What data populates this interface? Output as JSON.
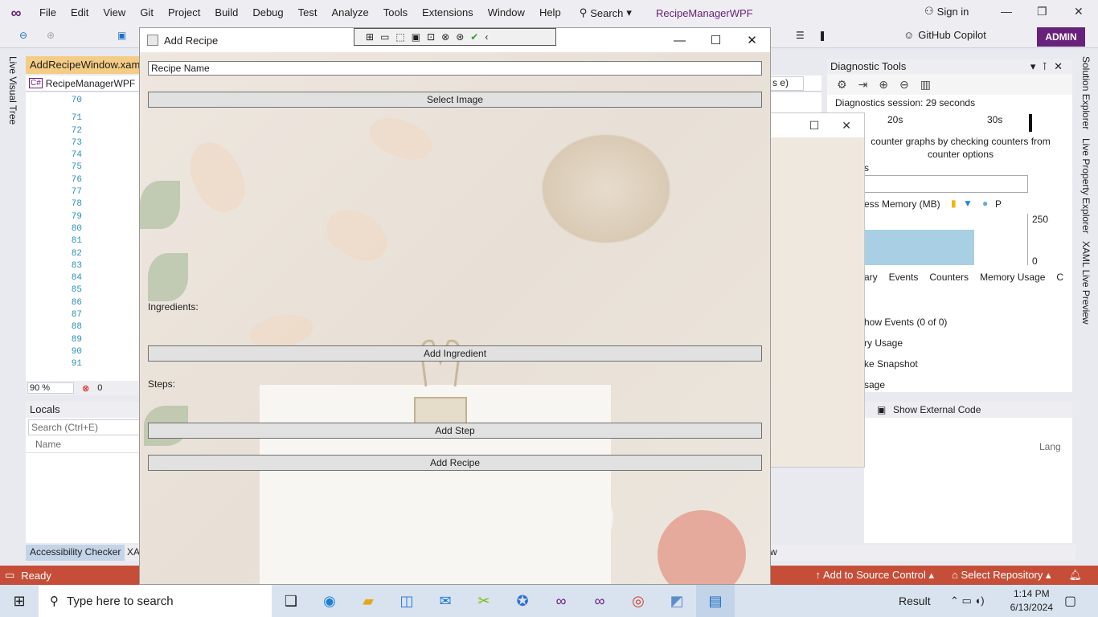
{
  "menubar": {
    "items": [
      "File",
      "Edit",
      "View",
      "Git",
      "Project",
      "Build",
      "Debug",
      "Test",
      "Analyze",
      "Tools",
      "Extensions",
      "Window",
      "Help"
    ],
    "search_label": "Search",
    "solution_name": "RecipeManagerWPF",
    "sign_in": "Sign in"
  },
  "toolbar": {
    "copilot_label": "GitHub Copilot",
    "admin_badge": "ADMIN"
  },
  "left_rail": {
    "tab": "Live Visual Tree"
  },
  "right_rail": {
    "tabs": [
      "Solution Explorer",
      "Live Property Explorer",
      "XAML Live Preview"
    ]
  },
  "editor": {
    "tab_label": "AddRecipeWindow.xaml",
    "project_dropdown": "RecipeManagerWPF",
    "line_numbers": [
      "70",
      "",
      "71",
      "72",
      "73",
      "74",
      "75",
      "76",
      "77",
      "78",
      "79",
      "80",
      "81",
      "82",
      "83",
      "84",
      "85",
      "86",
      "87",
      "88",
      "89",
      "90",
      "91"
    ],
    "zoom": "90 %",
    "error_count": "0",
    "member_dropdown": "s e)"
  },
  "locals": {
    "title": "Locals",
    "search_placeholder": "Search (Ctrl+E)",
    "column_name": "Name",
    "column_lang": "Lang"
  },
  "diagnostics": {
    "title": "Diagnostic Tools",
    "session": "Diagnostics session: 29 seconds",
    "timeline_20": "20s",
    "timeline_30": "30s",
    "hint": "counter graphs by checking counters from counter options",
    "section_events": "s",
    "memory_label": "ess Memory (MB)",
    "memory_legend_p": "P",
    "y_max": "250",
    "y_min": "0",
    "tabs": [
      "ary",
      "Events",
      "Counters",
      "Memory Usage",
      "C"
    ],
    "rows": [
      "how Events (0 of 0)",
      "ry Usage",
      "ke Snapshot",
      "sage"
    ]
  },
  "call_stack": {
    "show_external": "Show External Code"
  },
  "bottom_tabs": {
    "accessibility": "Accessibility Checker",
    "xa": "XA",
    "w": "w"
  },
  "statusbar": {
    "ready": "Ready",
    "add_source": "Add to Source Control",
    "select_repo": "Select Repository"
  },
  "taskbar": {
    "search_placeholder": "Type here to search",
    "result": "Result",
    "time": "1:14 PM",
    "date": "6/13/2024"
  },
  "dialog": {
    "title": "Add Recipe",
    "recipe_name_value": "Recipe Name",
    "select_image": "Select Image",
    "ingredients_label": "Ingredients:",
    "add_ingredient": "Add Ingredient",
    "steps_label": "Steps:",
    "add_step": "Add Step",
    "add_recipe": "Add Recipe"
  }
}
